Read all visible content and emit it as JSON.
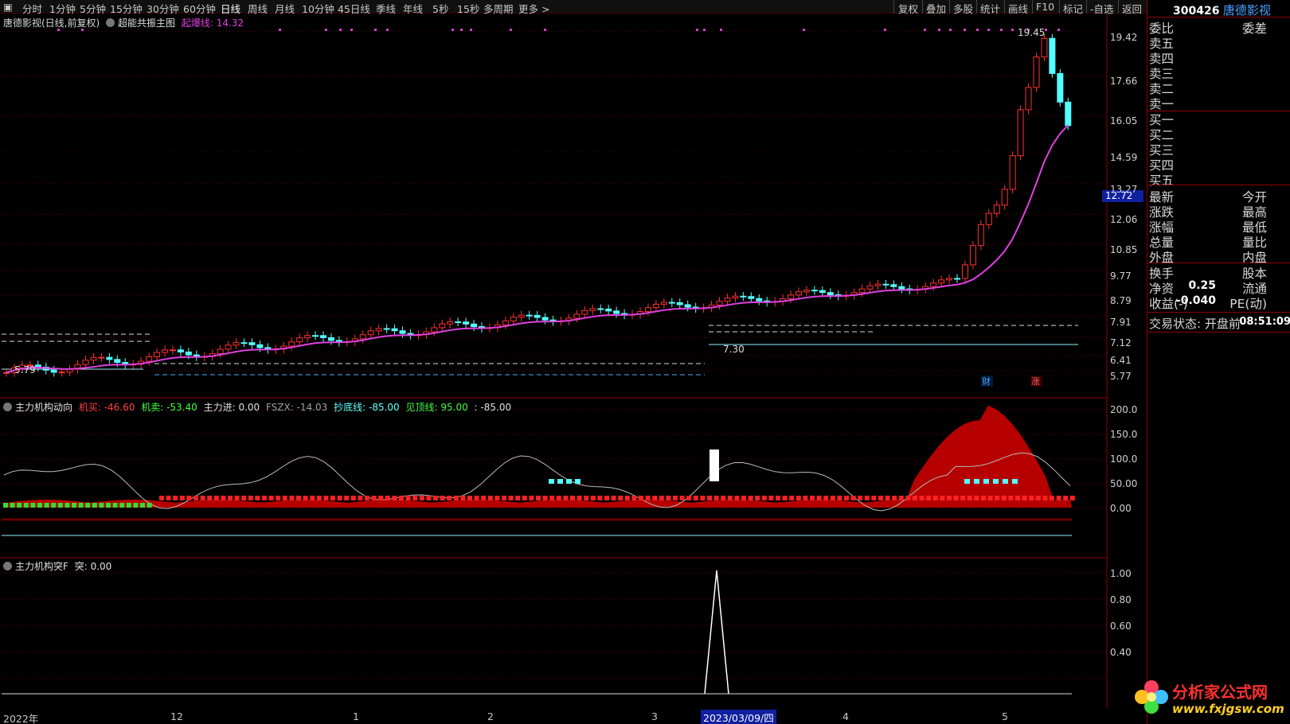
{
  "toolbar": {
    "items": [
      "分时",
      "1分钟",
      "5分钟",
      "15分钟",
      "30分钟",
      "60分钟",
      "日线",
      "周线",
      "月线",
      "10分钟",
      "45日线",
      "季线",
      "年线",
      "5秒",
      "15秒",
      "多周期",
      "更多 >"
    ],
    "right_items": [
      "复权",
      "叠加",
      "多股",
      "统计",
      "画线",
      "F10",
      "标记",
      "-自选",
      "返回"
    ]
  },
  "main_panel": {
    "title": "唐德影视(日线,前复权)",
    "indicator_name": "超能共振主图",
    "indicator_label": "起爆线: 14.32",
    "high_label": "19.45",
    "low_label": "5.79",
    "mid_label": "7.30",
    "current_price_tag": "12.72",
    "markers": [
      "财",
      "涨"
    ],
    "axis": [
      "19.42",
      "17.66",
      "16.05",
      "14.59",
      "13.27",
      "12.06",
      "10.85",
      "9.77",
      "8.79",
      "7.91",
      "7.12",
      "6.41",
      "5.77"
    ]
  },
  "sub1": {
    "title": "主力机构动向",
    "values": [
      "机买: -46.60",
      "机卖: -53.40",
      "主力进: 0.00",
      "FSZX: -14.03",
      "抄底线: -85.00",
      "见顶线: 95.00",
      ": -85.00"
    ],
    "axis": [
      "200.0",
      "150.0",
      "100.0",
      "50.00",
      "0.00"
    ]
  },
  "sub2": {
    "title": "主力机构突F",
    "value": "突: 0.00",
    "axis": [
      "1.00",
      "0.80",
      "0.60",
      "0.40"
    ]
  },
  "dates": {
    "labels": [
      "2022年",
      "12",
      "1",
      "2",
      "3",
      "4",
      "5"
    ],
    "highlight": "2023/03/09/四"
  },
  "info": {
    "code": "300426",
    "name": "唐德影视",
    "rows": [
      {
        "l": "委比",
        "r": "委差"
      },
      {
        "l": "卖五",
        "r": ""
      },
      {
        "l": "卖四",
        "r": ""
      },
      {
        "l": "卖三",
        "r": ""
      },
      {
        "l": "卖二",
        "r": ""
      },
      {
        "l": "卖一",
        "r": ""
      },
      {
        "l": "买一",
        "r": ""
      },
      {
        "l": "买二",
        "r": ""
      },
      {
        "l": "买三",
        "r": ""
      },
      {
        "l": "买四",
        "r": ""
      },
      {
        "l": "买五",
        "r": ""
      },
      {
        "l": "最新",
        "r": "今开"
      },
      {
        "l": "涨跌",
        "r": "最高"
      },
      {
        "l": "涨幅",
        "r": "最低"
      },
      {
        "l": "总量",
        "r": "量比"
      },
      {
        "l": "外盘",
        "r": "内盘"
      },
      {
        "l": "换手",
        "r": "股本"
      },
      {
        "l": "净资",
        "v": "0.25",
        "r": "流通"
      },
      {
        "l": "收益(-)",
        "v": "-0.040",
        "r": "PE(动)"
      }
    ],
    "status_label": "交易状态: 开盘前",
    "status_time": "08:51:09"
  },
  "watermark": {
    "title": "分析家公式网",
    "url": "www.fxjgsw.com"
  },
  "colors": {
    "up": "#ff3030",
    "down": "#54ffff",
    "ma": "#e040e0",
    "grid": "#5a0000"
  }
}
